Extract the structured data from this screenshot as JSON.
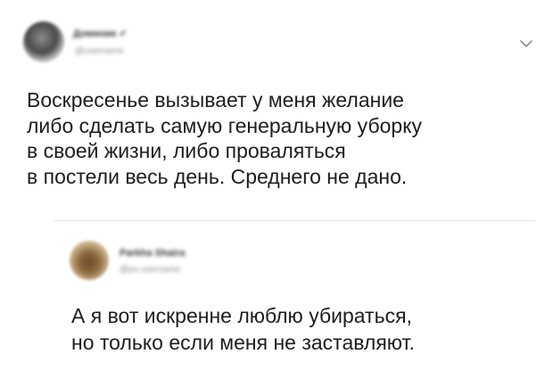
{
  "tweet": {
    "author_name": "Доминик ✔",
    "author_handle": "@username",
    "lines": [
      "Воскресенье вызывает у меня желание",
      "либо сделать самую генеральную уборку",
      "в своей жизни, либо проваляться",
      "в постели весь день. Среднего не дано."
    ]
  },
  "reply": {
    "author_name": "Parkha Shaira",
    "author_handle": "@ps.username",
    "lines": [
      "А я вот искренне люблю убираться,",
      "но только если меня не заставляют."
    ]
  },
  "icons": {
    "menu": "chevron-down-icon"
  }
}
